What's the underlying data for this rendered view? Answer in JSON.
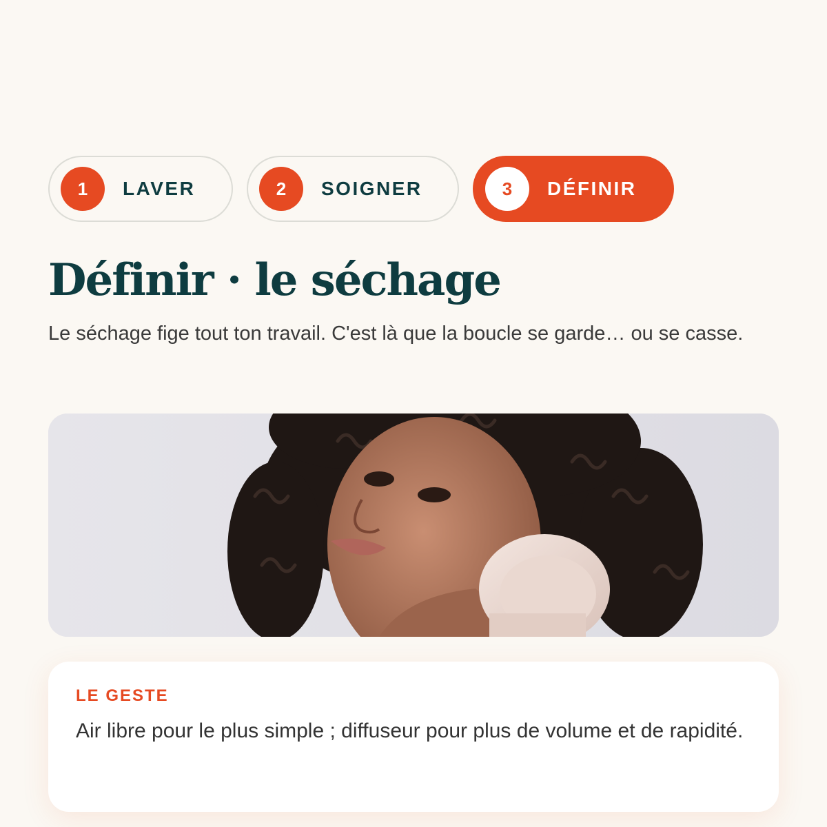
{
  "steps": [
    {
      "number": "1",
      "label": "LAVER",
      "active": false
    },
    {
      "number": "2",
      "label": "SOIGNER",
      "active": false
    },
    {
      "number": "3",
      "label": "DÉFINIR",
      "active": true
    }
  ],
  "heading": {
    "title": "Définir · le séchage",
    "subtitle": "Le séchage fige tout ton travail. C'est là que la boucle se garde… ou se casse."
  },
  "tip_card": {
    "kicker": "LE GESTE",
    "text": "Air libre pour le plus simple ; diffuseur pour plus de volume et de rapidité."
  },
  "colors": {
    "accent": "#e64a22",
    "title": "#0e3c40",
    "background": "#fbf8f3"
  }
}
